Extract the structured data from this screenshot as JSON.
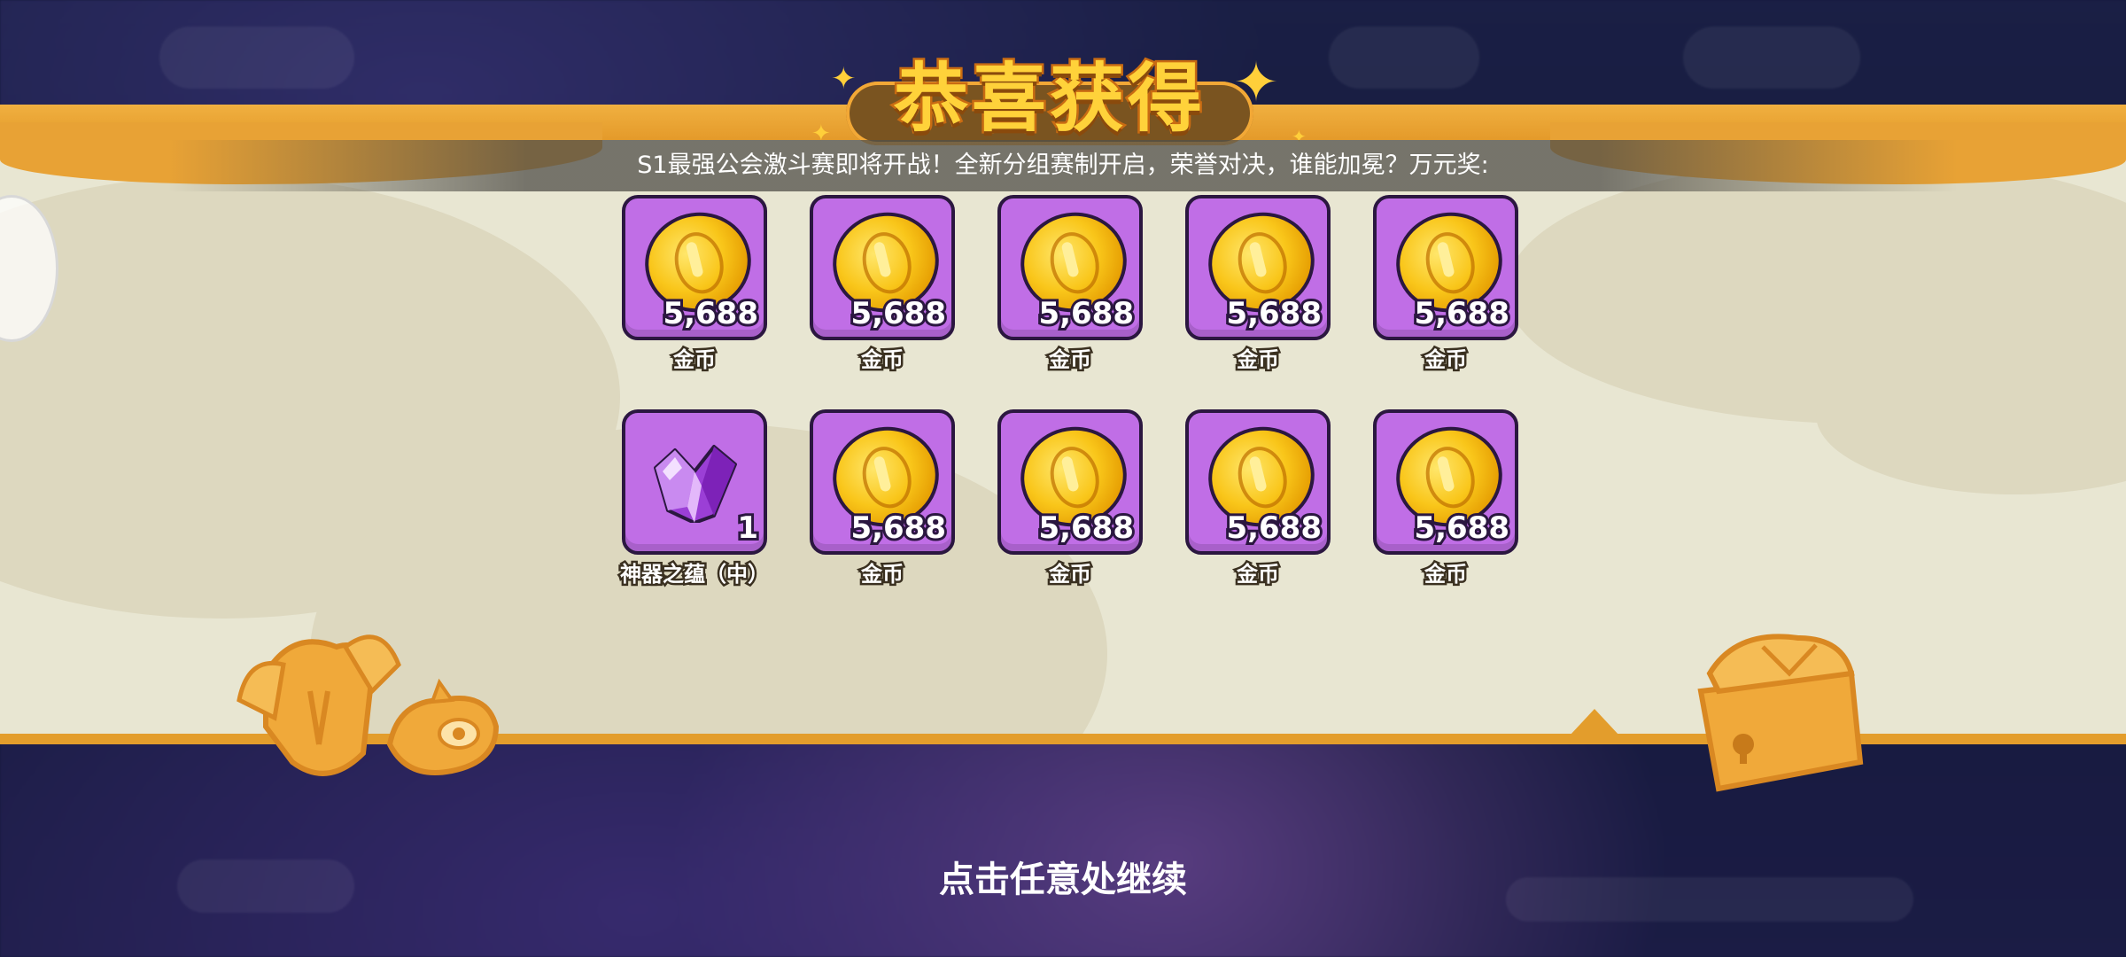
{
  "title": "恭喜获得",
  "marquee": "S1最强公会激斗赛即将开战！全新分组赛制开启，荣誉对决，谁能加冕？万元奖:",
  "rewards": [
    {
      "icon": "gold-coin-icon",
      "count": "5,688",
      "name": "金币"
    },
    {
      "icon": "gold-coin-icon",
      "count": "5,688",
      "name": "金币"
    },
    {
      "icon": "gold-coin-icon",
      "count": "5,688",
      "name": "金币"
    },
    {
      "icon": "gold-coin-icon",
      "count": "5,688",
      "name": "金币"
    },
    {
      "icon": "gold-coin-icon",
      "count": "5,688",
      "name": "金币"
    },
    {
      "icon": "purple-crystal-icon",
      "count": "1",
      "name": "神器之蕴（中）"
    },
    {
      "icon": "gold-coin-icon",
      "count": "5,688",
      "name": "金币"
    },
    {
      "icon": "gold-coin-icon",
      "count": "5,688",
      "name": "金币"
    },
    {
      "icon": "gold-coin-icon",
      "count": "5,688",
      "name": "金币"
    },
    {
      "icon": "gold-coin-icon",
      "count": "5,688",
      "name": "金币"
    }
  ],
  "continue_hint": "点击任意处继续",
  "colors": {
    "banner": "#e8e6d2",
    "banner_trim": "#e39d2c",
    "title_fill": "#ffd23a",
    "tile_bg": "#c06ee6",
    "tile_border": "#2b1740"
  }
}
